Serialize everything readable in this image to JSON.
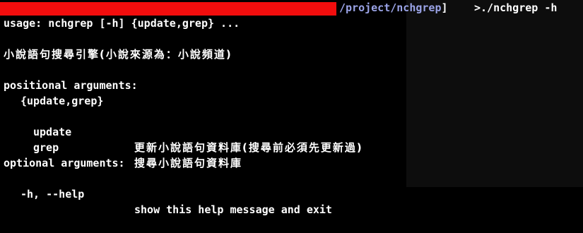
{
  "prompt": {
    "path": "/project/nchgrep",
    "bracket": "]",
    "command": ">./nchgrep -h"
  },
  "output": {
    "usage": "usage: nchgrep [-h] {update,grep} ...",
    "description": "小說語句搜尋引擎(小說來源為：小說頻道)",
    "positional_header": "positional arguments:",
    "subcommands": "{update,grep}",
    "args": [
      {
        "name": "update",
        "help": "更新小說語句資料庫(搜尋前必須先更新過)"
      },
      {
        "name": "grep",
        "help": "搜尋小說語句資料庫"
      }
    ],
    "optional_header": "optional arguments:",
    "options": [
      {
        "flag": "-h, --help",
        "help": "show this help message and exit"
      }
    ]
  },
  "colors": {
    "redaction": "#f20d0d",
    "path": "#9aa3e6",
    "text": "#ffffff",
    "background": "#000000"
  }
}
